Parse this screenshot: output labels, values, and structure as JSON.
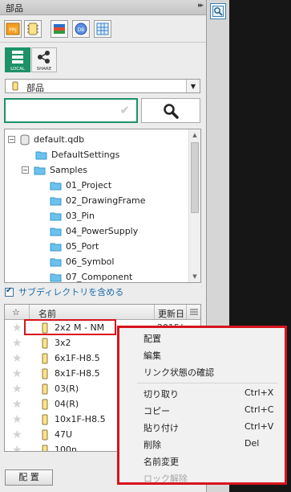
{
  "panel": {
    "title": "部品",
    "collapse_glyph": "▸▸"
  },
  "toolbar": {
    "buttons": [
      {
        "icon": "prj-icon",
        "label": "PRJ"
      },
      {
        "icon": "part-icon",
        "label": ""
      },
      {
        "icon": "library-stack-icon",
        "label": ""
      },
      {
        "icon": "db-icon",
        "label": "DB"
      },
      {
        "icon": "grid-calc-icon",
        "label": ""
      }
    ]
  },
  "mode": {
    "local_label": "LOCAL",
    "share_label": "SHARE"
  },
  "category": {
    "selected": "部品"
  },
  "search": {
    "value": "",
    "placeholder": ""
  },
  "tree": {
    "root": "default.qdb",
    "items": [
      {
        "label": "DefaultSettings"
      },
      {
        "label": "Samples"
      },
      {
        "label": "01_Project"
      },
      {
        "label": "02_DrawingFrame"
      },
      {
        "label": "03_Pin"
      },
      {
        "label": "04_PowerSupply"
      },
      {
        "label": "05_Port"
      },
      {
        "label": "06_Symbol"
      },
      {
        "label": "07_Component"
      }
    ]
  },
  "subdirs": {
    "label": "サブディレクトリを含める",
    "checked": true
  },
  "list": {
    "columns": {
      "star": "☆",
      "name": "名前",
      "date": "更新日"
    },
    "rows": [
      {
        "name": "2x2 M - NM",
        "date": "2015/"
      },
      {
        "name": "3x2",
        "date": ""
      },
      {
        "name": "6x1F-H8.5",
        "date": ""
      },
      {
        "name": "8x1F-H8.5",
        "date": ""
      },
      {
        "name": "03(R)",
        "date": ""
      },
      {
        "name": "04(R)",
        "date": ""
      },
      {
        "name": "10x1F-H8.5",
        "date": ""
      },
      {
        "name": "47U",
        "date": ""
      },
      {
        "name": "100n",
        "date": ""
      }
    ]
  },
  "place_button": "配 置",
  "context_menu": {
    "items": [
      {
        "label": "配置",
        "shortcut": "",
        "disabled": false
      },
      {
        "label": "編集",
        "shortcut": "",
        "disabled": false
      },
      {
        "label": "リンク状態の確認",
        "shortcut": "",
        "disabled": false
      },
      {
        "label": "切り取り",
        "shortcut": "Ctrl+X",
        "disabled": false
      },
      {
        "label": "コピー",
        "shortcut": "Ctrl+C",
        "disabled": false
      },
      {
        "label": "貼り付け",
        "shortcut": "Ctrl+V",
        "disabled": false
      },
      {
        "label": "削除",
        "shortcut": "Del",
        "disabled": false
      },
      {
        "label": "名前変更",
        "shortcut": "",
        "disabled": false
      },
      {
        "label": "ロック解除",
        "shortcut": "",
        "disabled": true
      }
    ]
  },
  "colors": {
    "accent": "#1e9168",
    "highlight": "#d7141c",
    "link": "#1f6ea8"
  }
}
